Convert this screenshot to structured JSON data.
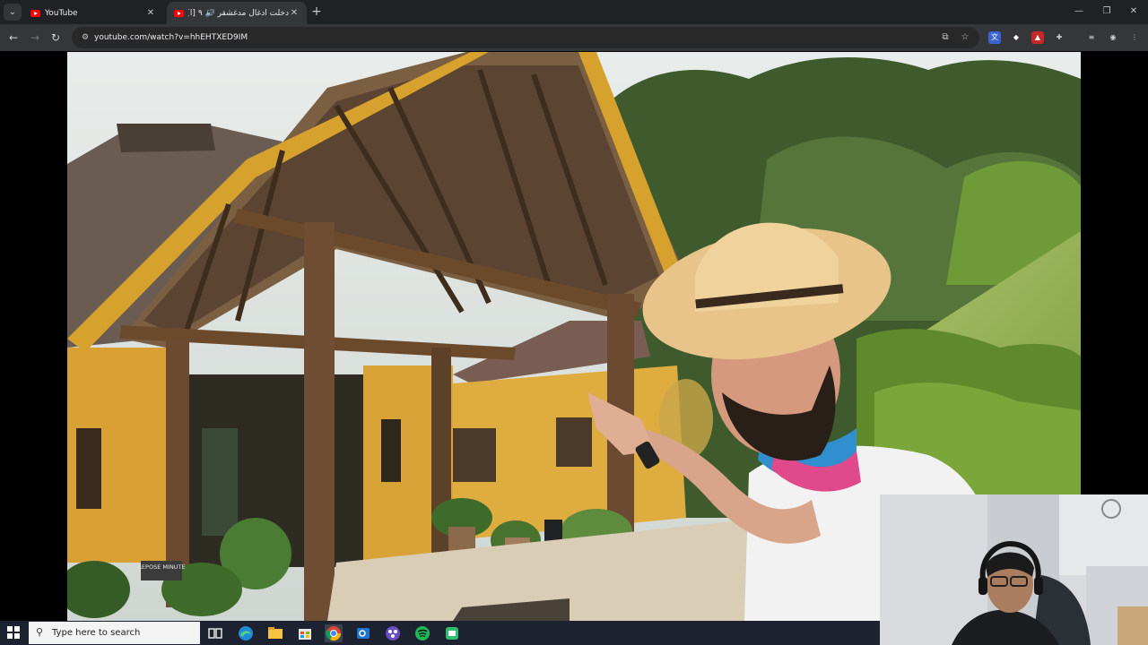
{
  "browser": {
    "tabs": [
      {
        "title": "YouTube",
        "active": false
      },
      {
        "title": "دخلت أدغال مدغشقر 🔊 ۹ [أ]",
        "active": true
      }
    ],
    "url": "youtube.com/watch?v=hhEHTXED9IM"
  },
  "video": {
    "sign_text": "REPOSE MINUTE"
  },
  "taskbar": {
    "search_placeholder": "Type here to search"
  },
  "colors": {
    "tab_strip": "#202124",
    "toolbar": "#35363a",
    "taskbar": "#1c2230",
    "youtube_red": "#ff0000"
  }
}
